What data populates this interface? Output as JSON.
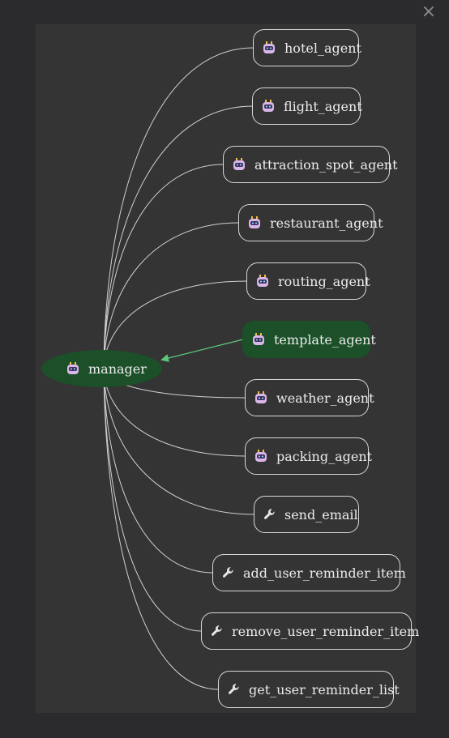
{
  "close_label": "×",
  "manager": {
    "label": "manager",
    "icon": "robot-icon"
  },
  "nodes": [
    {
      "label": "hotel_agent",
      "icon": "robot-icon",
      "active": false
    },
    {
      "label": "flight_agent",
      "icon": "robot-icon",
      "active": false
    },
    {
      "label": "attraction_spot_agent",
      "icon": "robot-icon",
      "active": false
    },
    {
      "label": "restaurant_agent",
      "icon": "robot-icon",
      "active": false
    },
    {
      "label": "routing_agent",
      "icon": "robot-icon",
      "active": false
    },
    {
      "label": "template_agent",
      "icon": "robot-icon",
      "active": true
    },
    {
      "label": "weather_agent",
      "icon": "robot-icon",
      "active": false
    },
    {
      "label": "packing_agent",
      "icon": "robot-icon",
      "active": false
    },
    {
      "label": "send_email",
      "icon": "wrench-icon",
      "active": false
    },
    {
      "label": "add_user_reminder_item",
      "icon": "wrench-icon",
      "active": false
    },
    {
      "label": "remove_user_reminder_item",
      "icon": "wrench-icon",
      "active": false
    },
    {
      "label": "get_user_reminder_list",
      "icon": "wrench-icon",
      "active": false
    }
  ],
  "colors": {
    "active_node": "#1b5028",
    "active_edge": "#5ec87a",
    "edge": "#d0d0d0"
  }
}
